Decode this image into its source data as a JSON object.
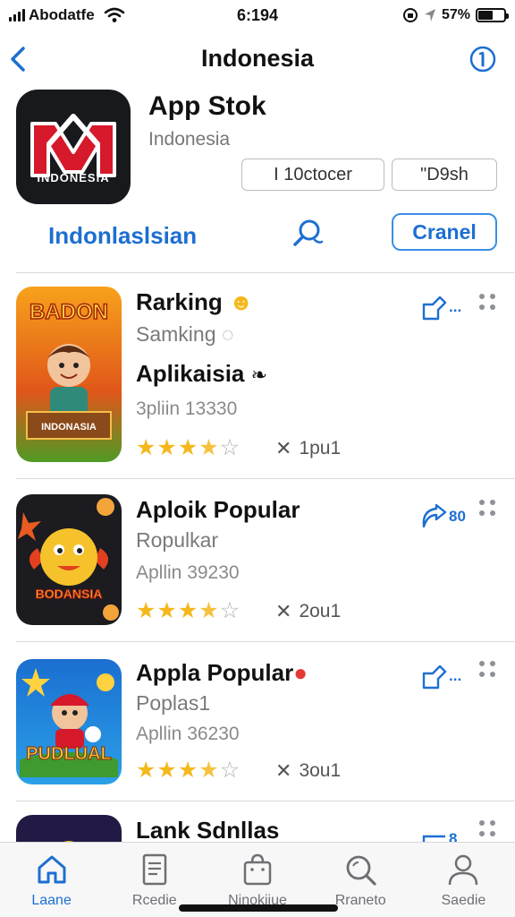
{
  "status_bar": {
    "carrier": "Abodatfe",
    "time": "6:194",
    "battery": "57%",
    "battery_level": 0.57
  },
  "nav": {
    "title": "Indonesia",
    "back_icon": "chevron-left-icon",
    "info_icon": "info-icon"
  },
  "app": {
    "icon_brand": "INDONESIA",
    "name": "App Stok",
    "subtitle": "Indonesia",
    "pill1": "I 10ctocer",
    "pill2": "\"D9sh",
    "lang_link": "Indonlaslsian",
    "cancel_label": "Cranel"
  },
  "items": [
    {
      "thumb_text": "BADON",
      "thumb_banner": "INDONASIA",
      "title": "Rarking",
      "subtitle": "Samking",
      "extra": "Aplikaisia",
      "extra_mark": "ཿ",
      "meta": "3pliin 13330",
      "rating": 3.5,
      "downloads": "1pu1",
      "share_text": "..."
    },
    {
      "thumb_banner": "BODANSIA",
      "title": "Aploik Popular",
      "subtitle": "Ropulkar",
      "meta": "Apllin 39230",
      "rating": 3.5,
      "downloads": "2ou1",
      "share_text": "80"
    },
    {
      "thumb_banner": "PUDLUAL",
      "title": "Appla Popular",
      "subtitle": "Poplas1",
      "meta": "Apllin 36230",
      "rating": 3.5,
      "downloads": "3ou1",
      "share_text": "..."
    },
    {
      "title": "Lank Sdnllas",
      "share_text": "8"
    }
  ],
  "tabs": [
    {
      "label": "Laane",
      "icon": "home-icon",
      "active": true
    },
    {
      "label": "Rcedie",
      "icon": "document-icon",
      "active": false
    },
    {
      "label": "Ninokiiue",
      "icon": "bag-icon",
      "active": false
    },
    {
      "label": "Rraneto",
      "icon": "search-icon",
      "active": false
    },
    {
      "label": "Saedie",
      "icon": "person-icon",
      "active": false
    }
  ],
  "colors": {
    "accent": "#1d6fd1",
    "star": "#f5b81c",
    "brand_red": "#d6192b"
  }
}
